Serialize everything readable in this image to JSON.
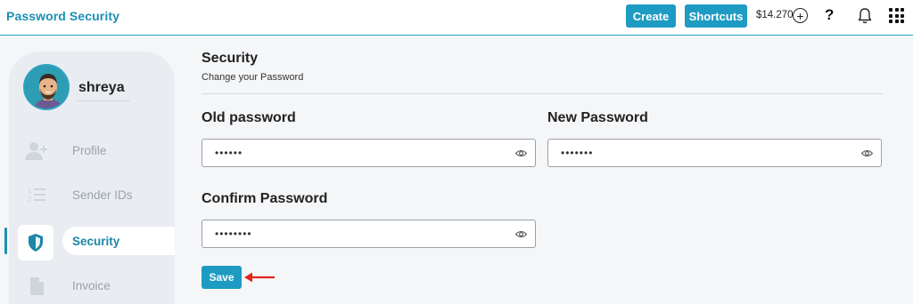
{
  "app": {
    "title": "Password Security"
  },
  "topbar": {
    "create_label": "Create",
    "shortcuts_label": "Shortcuts",
    "balance": "$14.270",
    "help_glyph": "?"
  },
  "profile": {
    "username": "shreya"
  },
  "sidebar": {
    "items": [
      {
        "label": "Profile",
        "icon": "add-user-icon"
      },
      {
        "label": "Sender IDs",
        "icon": "numbered-list-icon"
      },
      {
        "label": "Security",
        "icon": "shield-icon",
        "active": true
      },
      {
        "label": "Invoice",
        "icon": "document-icon"
      }
    ]
  },
  "section": {
    "title": "Security",
    "subtitle": "Change your Password"
  },
  "form": {
    "old_password": {
      "label": "Old password",
      "value": "••••••"
    },
    "new_password": {
      "label": "New Password",
      "value": "•••••••"
    },
    "confirm_password": {
      "label": "Confirm Password",
      "value": "••••••••"
    },
    "save_label": "Save"
  },
  "colors": {
    "accent": "#1e9bc2",
    "arrow": "#e0261b"
  }
}
